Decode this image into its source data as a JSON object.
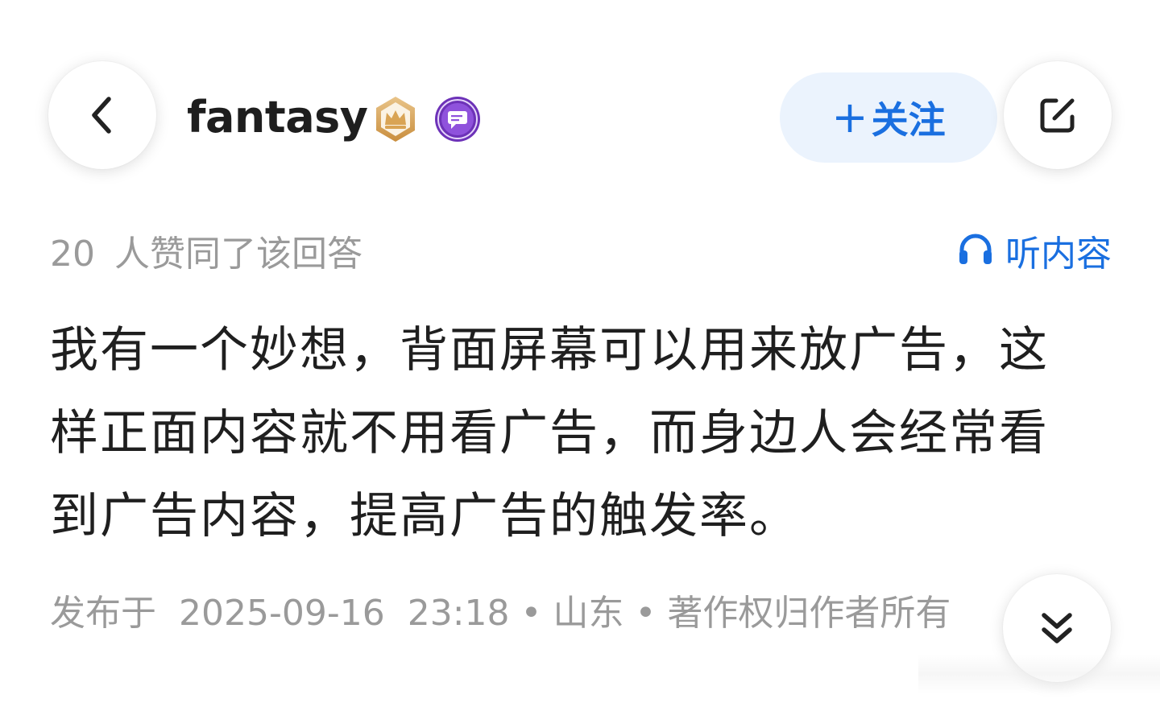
{
  "header": {
    "back_icon": "chevron-left-icon",
    "username": "fantasy",
    "badges": [
      "crown-badge-icon",
      "chat-badge-icon"
    ],
    "follow_plus": "+",
    "follow_label": "关注",
    "edit_icon": "edit-icon"
  },
  "stats": {
    "agree_count": "20",
    "agree_text": "人赞同了该回答"
  },
  "listen": {
    "icon": "headphones-icon",
    "label": "听内容"
  },
  "answer": {
    "body": "我有一个妙想，背面屏幕可以用来放广告，这样正面内容就不用看广告，而身边人会经常看到广告内容，提高广告的触发率。"
  },
  "meta": {
    "published_prefix": "发布于",
    "date": "2025-09-16",
    "time": "23:18",
    "separator": "•",
    "location": "山东",
    "copyright": "著作权归作者所有"
  },
  "expand": {
    "icon": "double-chevron-down-icon"
  },
  "colors": {
    "accent": "#1a6fe0",
    "follow_bg": "#ebf3fd",
    "muted_text": "#9a9a9a",
    "crown_badge": "#d4a15a",
    "chat_badge": "#7b3fc4"
  }
}
